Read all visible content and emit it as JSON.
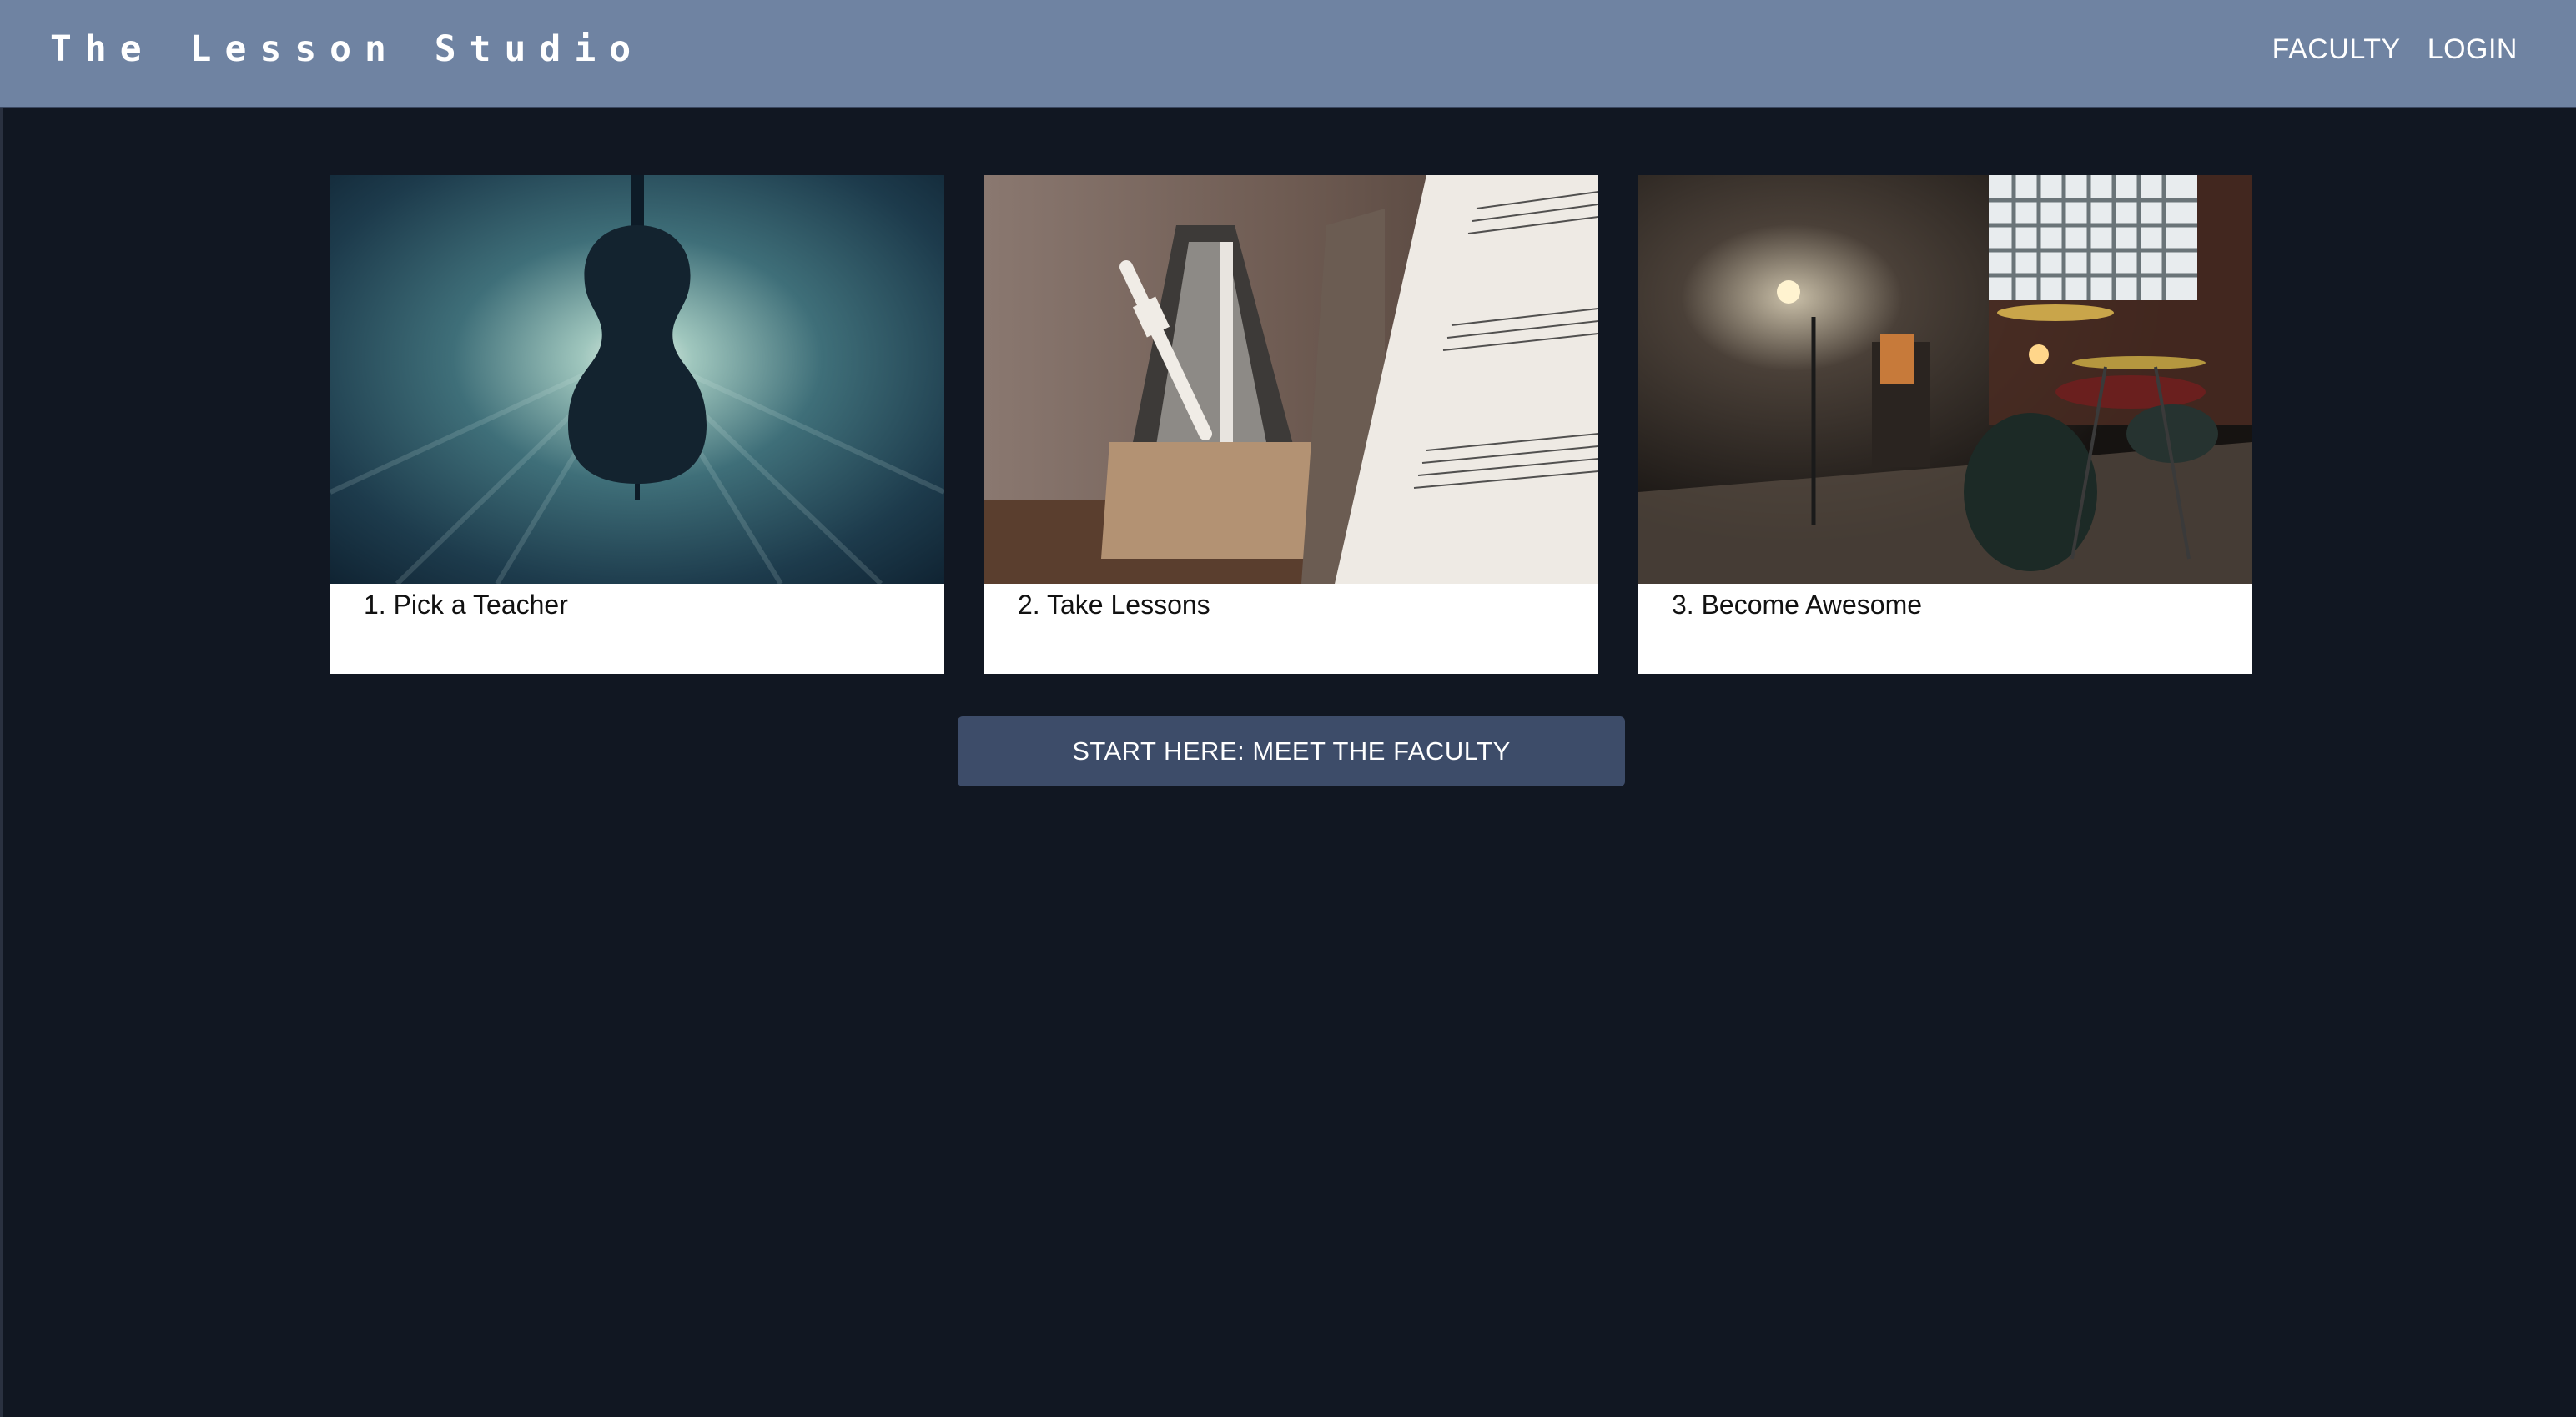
{
  "header": {
    "brand": "The Lesson Studio",
    "nav": [
      {
        "label": "FACULTY"
      },
      {
        "label": "LOGIN"
      }
    ]
  },
  "steps": [
    {
      "label": "1. Pick a Teacher",
      "image": "cello-underwater-photo"
    },
    {
      "label": "2. Take Lessons",
      "image": "metronome-sheet-music-photo"
    },
    {
      "label": "3. Become Awesome",
      "image": "drum-studio-photo"
    }
  ],
  "cta": {
    "label": "START HERE: MEET THE FACULTY"
  },
  "colors": {
    "navbar": "#6f83a2",
    "background": "#111722",
    "button": "#3d4c69",
    "card": "#ffffff"
  }
}
